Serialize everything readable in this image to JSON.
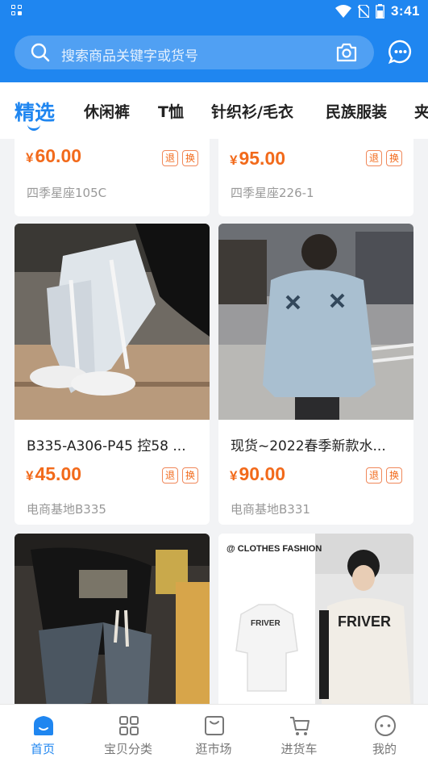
{
  "status_bar": {
    "time": "3:41"
  },
  "search": {
    "placeholder": "搜索商品关键字或货号",
    "icons": [
      "search-icon",
      "camera-icon",
      "chat-icon"
    ]
  },
  "tabs": [
    "精选",
    "休闲裤",
    "T恤",
    "针织衫/毛衣",
    "民族服装",
    "夹"
  ],
  "active_tab": "精选",
  "products_top": [
    {
      "price": "60.00",
      "stall": "四季星座105C"
    },
    {
      "price": "95.00",
      "stall": "四季星座226-1"
    }
  ],
  "products": [
    {
      "title": "B335-A306-P45 控58 ...",
      "price": "45.00",
      "stall": "电商基地B335"
    },
    {
      "title": "现货~2022春季新款水...",
      "price": "90.00",
      "stall": "电商基地B331"
    }
  ],
  "product_image_texts": {
    "clothes_fashion": "@ CLOTHES FASHION",
    "friver": "FRIVER"
  },
  "currency": "¥",
  "badge_return": "退",
  "badge_exchange": "换",
  "bottom_nav": [
    "首页",
    "宝贝分类",
    "逛市场",
    "进货车",
    "我的"
  ],
  "colors": {
    "primary": "#1f86f0",
    "price": "#f26a1b",
    "muted": "#999999"
  }
}
